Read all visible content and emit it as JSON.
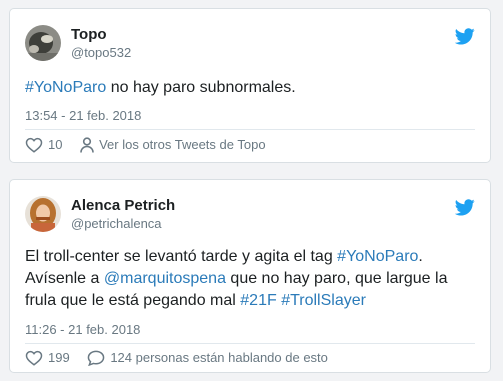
{
  "colors": {
    "link": "#2b7bb9",
    "secondary_text": "#697882",
    "twitter_blue": "#1da1f2"
  },
  "tweets": [
    {
      "name": "Topo",
      "handle": "@topo532",
      "text_parts": [
        {
          "text": "#YoNoParo",
          "link": true
        },
        {
          "text": " no hay paro subnormales.",
          "link": false
        }
      ],
      "timestamp": "13:54 - 21 feb. 2018",
      "like_count": "10",
      "secondary_action": "Ver los otros Tweets de Topo",
      "icons": {
        "avatar": "avatar-icon",
        "brand": "twitter-bird-icon",
        "like": "heart-icon",
        "secondary": "person-icon"
      }
    },
    {
      "name": "Alenca Petrich",
      "handle": "@petrichalenca",
      "text_parts": [
        {
          "text": "El troll-center se levantó tarde y agita el tag ",
          "link": false
        },
        {
          "text": "#YoNoParo",
          "link": true
        },
        {
          "text": ".",
          "link": false
        },
        {
          "text": "Avísenle a ",
          "link": false
        },
        {
          "text": "@marquitospena",
          "link": true
        },
        {
          "text": " que no hay paro, que largue la frula que le está pegando mal ",
          "link": false
        },
        {
          "text": "#21F",
          "link": true
        },
        {
          "text": " ",
          "link": false
        },
        {
          "text": "#TrollSlayer",
          "link": true
        }
      ],
      "timestamp": "11:26 - 21 feb. 2018",
      "like_count": "199",
      "secondary_action": "124 personas están hablando de esto",
      "icons": {
        "avatar": "avatar-icon",
        "brand": "twitter-bird-icon",
        "like": "heart-icon",
        "secondary": "speech-bubble-icon"
      }
    }
  ]
}
